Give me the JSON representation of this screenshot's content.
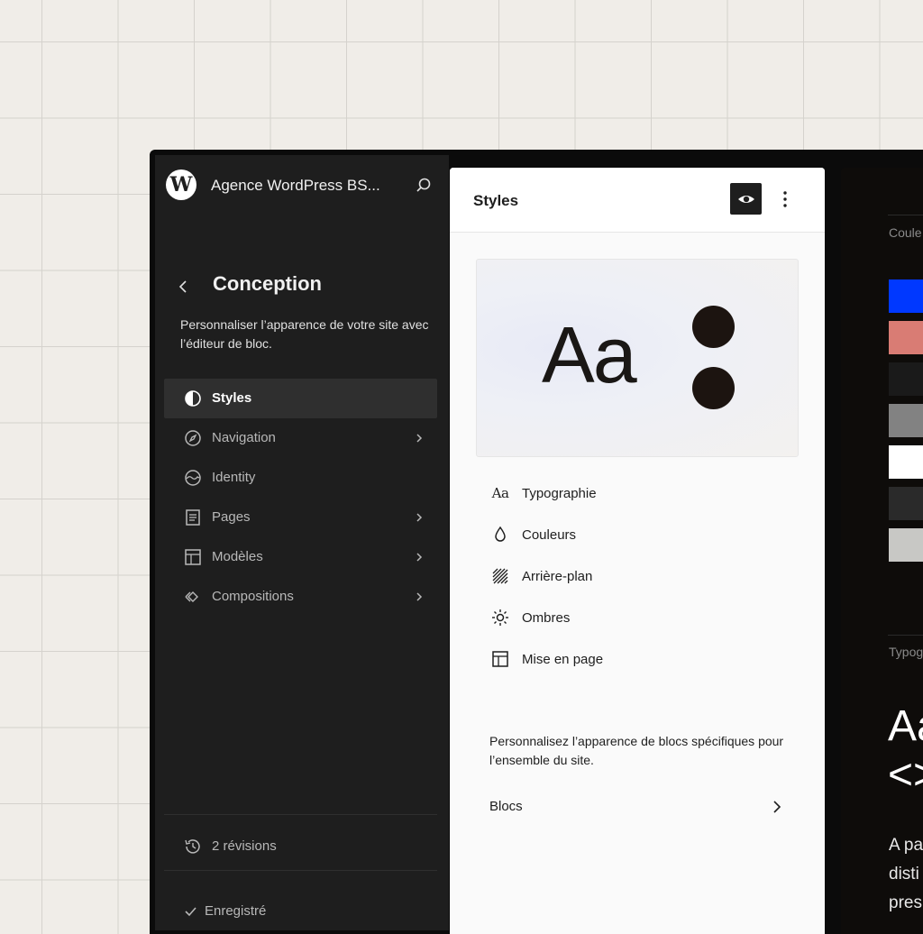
{
  "sidebar": {
    "site_title": "Agence WordPress BS...",
    "title": "Conception",
    "description": "Personnaliser l’apparence de votre site avec l’éditeur de bloc.",
    "items": [
      {
        "label": "Styles",
        "icon": "half-circle-icon",
        "active": true
      },
      {
        "label": "Navigation",
        "icon": "compass-icon",
        "chevron": true
      },
      {
        "label": "Identity",
        "icon": "identity-icon"
      },
      {
        "label": "Pages",
        "icon": "page-icon",
        "chevron": true
      },
      {
        "label": "Modèles",
        "icon": "layout-icon",
        "chevron": true
      },
      {
        "label": "Compositions",
        "icon": "diamond-icon",
        "chevron": true
      }
    ],
    "revisions": "2 révisions",
    "saved": "Enregistré"
  },
  "panel": {
    "title": "Styles",
    "preview_text": "Aa",
    "menu": [
      {
        "label": "Typographie",
        "icon": "typography-icon"
      },
      {
        "label": "Couleurs",
        "icon": "droplet-icon"
      },
      {
        "label": "Arrière-plan",
        "icon": "background-icon"
      },
      {
        "label": "Ombres",
        "icon": "shadow-icon"
      },
      {
        "label": "Mise en page",
        "icon": "layout-icon"
      }
    ],
    "blocks_description": "Personnalisez l’apparence de blocs spécifiques pour l’ensemble du site.",
    "blocks_label": "Blocs"
  },
  "canvas": {
    "colors_label": "Coule",
    "swatches": [
      "#0038ff",
      "#d97c74",
      "#1a1a1a",
      "#828282",
      "#ffffff",
      "#2a2a2a",
      "#c8c8c5"
    ],
    "typography_label": "Typog",
    "big_line1": "Aa",
    "big_line2": "<>",
    "para_lines": [
      "A pa",
      "disti",
      "pres"
    ]
  },
  "colors": {
    "sidebar_bg": "#1e1e1e",
    "panel_bg": "#fafafa",
    "dots": "#1c1410"
  }
}
